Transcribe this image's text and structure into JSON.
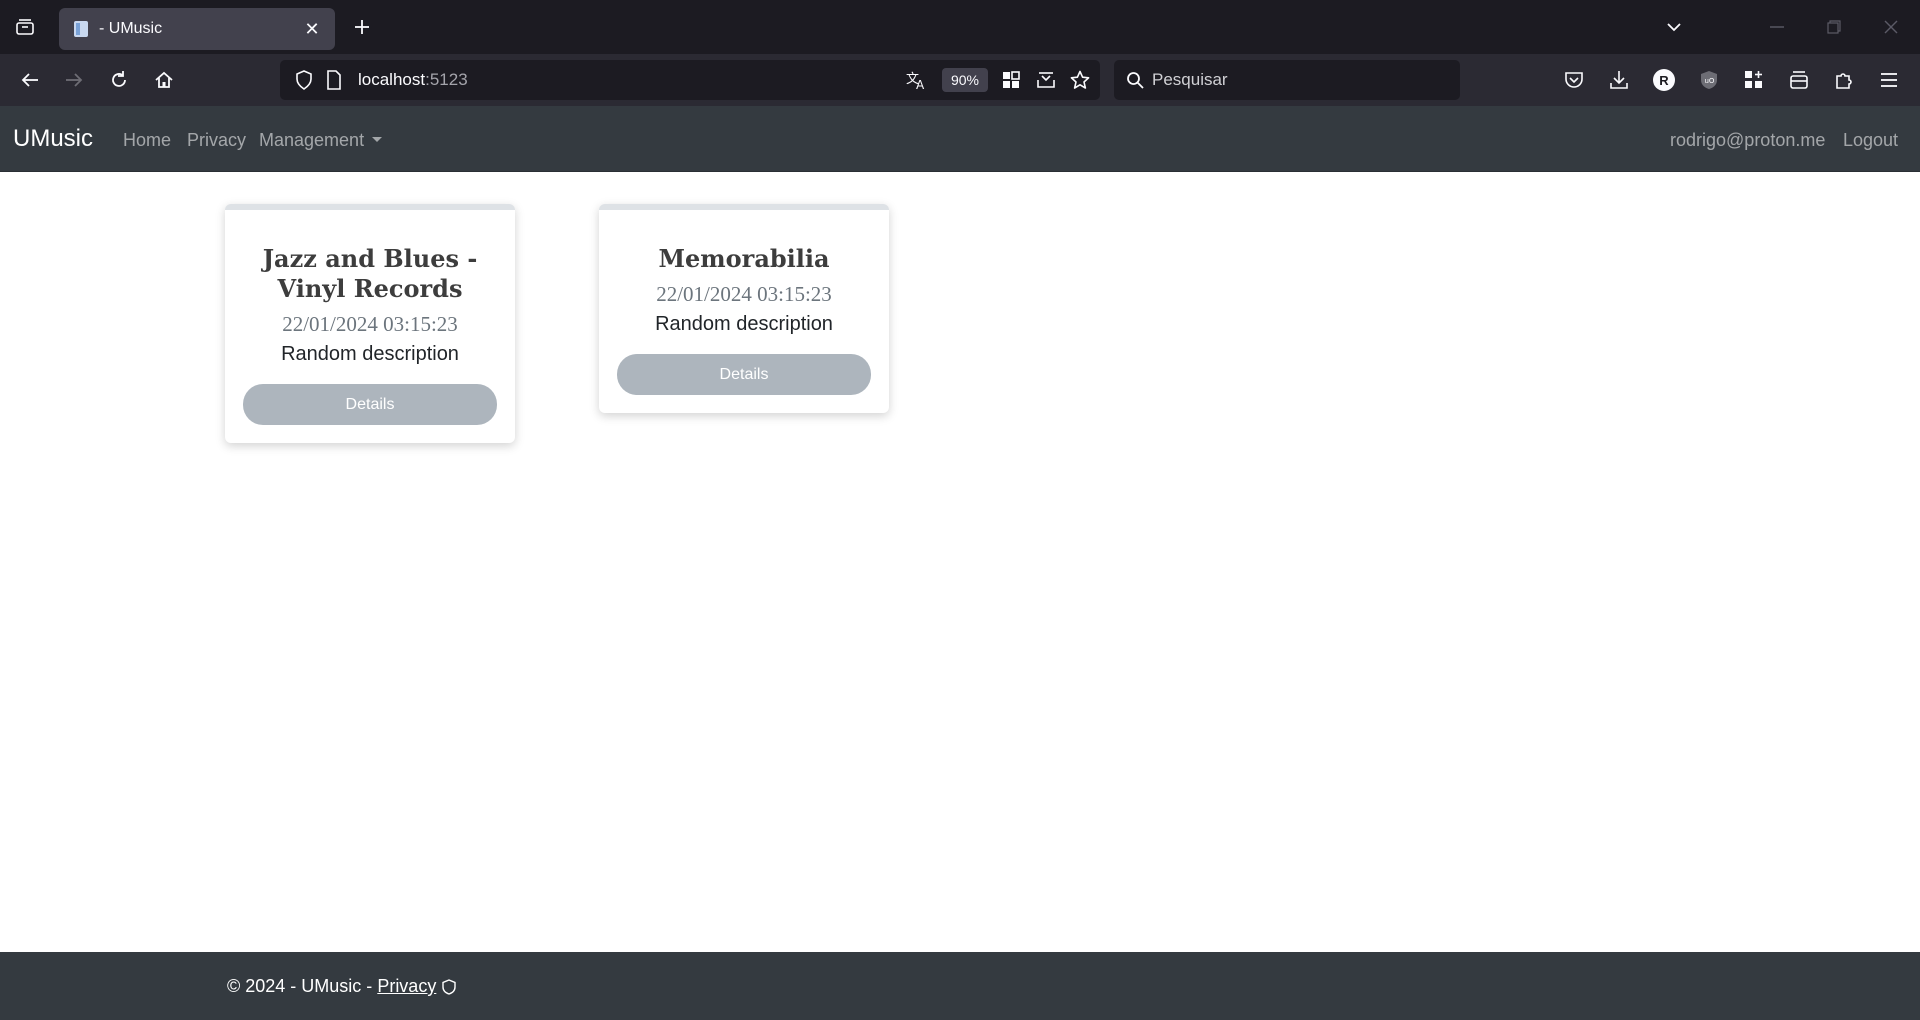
{
  "browser": {
    "tab": {
      "title": "- UMusic"
    },
    "url": {
      "host": "localhost",
      "port": ":5123"
    },
    "zoom": "90%",
    "search": {
      "placeholder": "Pesquisar"
    },
    "profile_initial": "R"
  },
  "site": {
    "brand": "UMusic",
    "nav": {
      "home": "Home",
      "privacy": "Privacy",
      "management": "Management"
    },
    "user": {
      "email": "rodrigo@proton.me",
      "logout": "Logout"
    }
  },
  "cards": [
    {
      "title": "Jazz and Blues - Vinyl Records",
      "date": "22/01/2024 03:15:23",
      "description": "Random description",
      "button": "Details"
    },
    {
      "title": "Memorabilia",
      "date": "22/01/2024 03:15:23",
      "description": "Random description",
      "button": "Details"
    }
  ],
  "footer": {
    "text": "© 2024 - UMusic -",
    "privacy_link": "Privacy"
  },
  "colors": {
    "navbar_bg": "#343a40",
    "button_bg": "#adb5bd",
    "browser_tabbar": "#1c1b22",
    "browser_toolbar": "#2b2a33"
  }
}
